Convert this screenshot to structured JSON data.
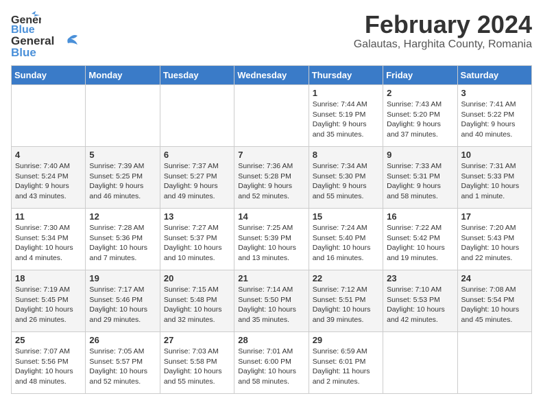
{
  "logo": {
    "line1": "General",
    "line2": "Blue"
  },
  "title": "February 2024",
  "location": "Galautas, Harghita County, Romania",
  "days_header": [
    "Sunday",
    "Monday",
    "Tuesday",
    "Wednesday",
    "Thursday",
    "Friday",
    "Saturday"
  ],
  "weeks": [
    [
      {
        "day": "",
        "info": ""
      },
      {
        "day": "",
        "info": ""
      },
      {
        "day": "",
        "info": ""
      },
      {
        "day": "",
        "info": ""
      },
      {
        "day": "1",
        "info": "Sunrise: 7:44 AM\nSunset: 5:19 PM\nDaylight: 9 hours\nand 35 minutes."
      },
      {
        "day": "2",
        "info": "Sunrise: 7:43 AM\nSunset: 5:20 PM\nDaylight: 9 hours\nand 37 minutes."
      },
      {
        "day": "3",
        "info": "Sunrise: 7:41 AM\nSunset: 5:22 PM\nDaylight: 9 hours\nand 40 minutes."
      }
    ],
    [
      {
        "day": "4",
        "info": "Sunrise: 7:40 AM\nSunset: 5:24 PM\nDaylight: 9 hours\nand 43 minutes."
      },
      {
        "day": "5",
        "info": "Sunrise: 7:39 AM\nSunset: 5:25 PM\nDaylight: 9 hours\nand 46 minutes."
      },
      {
        "day": "6",
        "info": "Sunrise: 7:37 AM\nSunset: 5:27 PM\nDaylight: 9 hours\nand 49 minutes."
      },
      {
        "day": "7",
        "info": "Sunrise: 7:36 AM\nSunset: 5:28 PM\nDaylight: 9 hours\nand 52 minutes."
      },
      {
        "day": "8",
        "info": "Sunrise: 7:34 AM\nSunset: 5:30 PM\nDaylight: 9 hours\nand 55 minutes."
      },
      {
        "day": "9",
        "info": "Sunrise: 7:33 AM\nSunset: 5:31 PM\nDaylight: 9 hours\nand 58 minutes."
      },
      {
        "day": "10",
        "info": "Sunrise: 7:31 AM\nSunset: 5:33 PM\nDaylight: 10 hours\nand 1 minute."
      }
    ],
    [
      {
        "day": "11",
        "info": "Sunrise: 7:30 AM\nSunset: 5:34 PM\nDaylight: 10 hours\nand 4 minutes."
      },
      {
        "day": "12",
        "info": "Sunrise: 7:28 AM\nSunset: 5:36 PM\nDaylight: 10 hours\nand 7 minutes."
      },
      {
        "day": "13",
        "info": "Sunrise: 7:27 AM\nSunset: 5:37 PM\nDaylight: 10 hours\nand 10 minutes."
      },
      {
        "day": "14",
        "info": "Sunrise: 7:25 AM\nSunset: 5:39 PM\nDaylight: 10 hours\nand 13 minutes."
      },
      {
        "day": "15",
        "info": "Sunrise: 7:24 AM\nSunset: 5:40 PM\nDaylight: 10 hours\nand 16 minutes."
      },
      {
        "day": "16",
        "info": "Sunrise: 7:22 AM\nSunset: 5:42 PM\nDaylight: 10 hours\nand 19 minutes."
      },
      {
        "day": "17",
        "info": "Sunrise: 7:20 AM\nSunset: 5:43 PM\nDaylight: 10 hours\nand 22 minutes."
      }
    ],
    [
      {
        "day": "18",
        "info": "Sunrise: 7:19 AM\nSunset: 5:45 PM\nDaylight: 10 hours\nand 26 minutes."
      },
      {
        "day": "19",
        "info": "Sunrise: 7:17 AM\nSunset: 5:46 PM\nDaylight: 10 hours\nand 29 minutes."
      },
      {
        "day": "20",
        "info": "Sunrise: 7:15 AM\nSunset: 5:48 PM\nDaylight: 10 hours\nand 32 minutes."
      },
      {
        "day": "21",
        "info": "Sunrise: 7:14 AM\nSunset: 5:50 PM\nDaylight: 10 hours\nand 35 minutes."
      },
      {
        "day": "22",
        "info": "Sunrise: 7:12 AM\nSunset: 5:51 PM\nDaylight: 10 hours\nand 39 minutes."
      },
      {
        "day": "23",
        "info": "Sunrise: 7:10 AM\nSunset: 5:53 PM\nDaylight: 10 hours\nand 42 minutes."
      },
      {
        "day": "24",
        "info": "Sunrise: 7:08 AM\nSunset: 5:54 PM\nDaylight: 10 hours\nand 45 minutes."
      }
    ],
    [
      {
        "day": "25",
        "info": "Sunrise: 7:07 AM\nSunset: 5:56 PM\nDaylight: 10 hours\nand 48 minutes."
      },
      {
        "day": "26",
        "info": "Sunrise: 7:05 AM\nSunset: 5:57 PM\nDaylight: 10 hours\nand 52 minutes."
      },
      {
        "day": "27",
        "info": "Sunrise: 7:03 AM\nSunset: 5:58 PM\nDaylight: 10 hours\nand 55 minutes."
      },
      {
        "day": "28",
        "info": "Sunrise: 7:01 AM\nSunset: 6:00 PM\nDaylight: 10 hours\nand 58 minutes."
      },
      {
        "day": "29",
        "info": "Sunrise: 6:59 AM\nSunset: 6:01 PM\nDaylight: 11 hours\nand 2 minutes."
      },
      {
        "day": "",
        "info": ""
      },
      {
        "day": "",
        "info": ""
      }
    ]
  ]
}
